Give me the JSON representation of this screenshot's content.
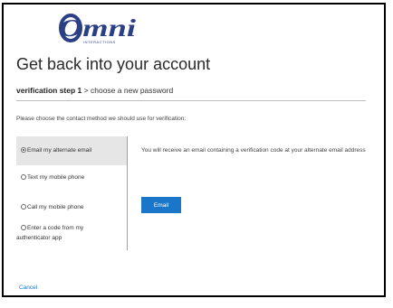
{
  "brand": {
    "logo_text": "Omni",
    "logo_subtext": "INTERACTIONS",
    "logo_color": "#2b3f87"
  },
  "title": "Get back into your account",
  "steps": {
    "current": "verification step 1",
    "separator": ">",
    "next": "choose a new password"
  },
  "prompt": "Please choose the contact method we should use for verification:",
  "options": [
    {
      "label_line1": "Email my alternate email",
      "label_line2": "",
      "selected": true
    },
    {
      "label_line1": "Text my mobile phone",
      "label_line2": "",
      "selected": false
    },
    {
      "label_line1": "Call my mobile phone",
      "label_line2": "",
      "selected": false
    },
    {
      "label_line1": "Enter a code from my",
      "label_line2": "authenticator app",
      "selected": false
    }
  ],
  "detail": {
    "description": "You will receive an email containing a verification code at your alternate email address",
    "button_label": "Email"
  },
  "cancel_label": "Cancel",
  "colors": {
    "accent": "#1976c8",
    "selected_bg": "#e6e6e6"
  }
}
